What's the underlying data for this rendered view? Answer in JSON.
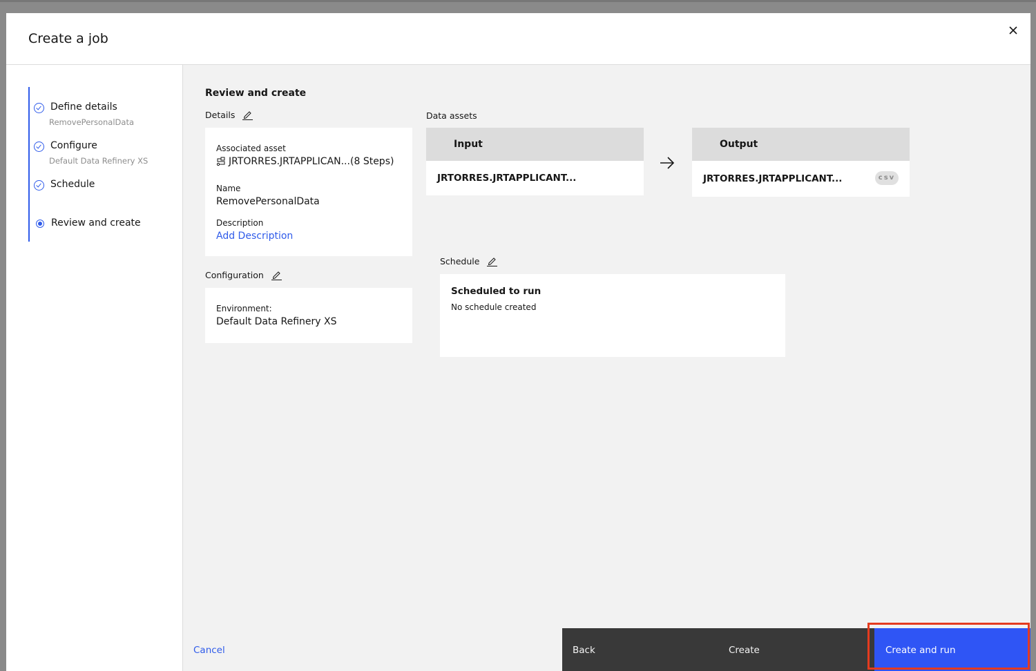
{
  "modal": {
    "title": "Create a job",
    "close_label": "×"
  },
  "steps": [
    {
      "label": "Define details",
      "sub": "RemovePersonalData",
      "status": "complete"
    },
    {
      "label": "Configure",
      "sub": "Default Data Refinery XS",
      "status": "complete"
    },
    {
      "label": "Schedule",
      "sub": "",
      "status": "complete"
    },
    {
      "label": "Review and create",
      "sub": "",
      "status": "current"
    }
  ],
  "review": {
    "title": "Review and create",
    "details": {
      "label": "Details",
      "associated_asset_label": "Associated asset",
      "associated_asset_value": "JRTORRES.JRTAPPLICAN...",
      "associated_asset_steps": "(8 Steps)",
      "name_label": "Name",
      "name_value": "RemovePersonalData",
      "description_label": "Description",
      "description_link": "Add Description"
    },
    "configuration": {
      "label": "Configuration",
      "environment_label": "Environment:",
      "environment_value": "Default Data Refinery XS"
    },
    "data_assets": {
      "label": "Data assets",
      "input_header": "Input",
      "input_value": "JRTORRES.JRTAPPLICANT...",
      "output_header": "Output",
      "output_value": "JRTORRES.JRTAPPLICANT...",
      "output_badge": "csv"
    },
    "schedule": {
      "label": "Schedule",
      "heading": "Scheduled to run",
      "value": "No schedule created"
    }
  },
  "footer": {
    "cancel": "Cancel",
    "back": "Back",
    "create": "Create",
    "create_and_run": "Create and run"
  },
  "colors": {
    "accent": "#2f55f5",
    "link": "#2f5bea",
    "secondary_button": "#393939",
    "highlight": "#e53b1f"
  }
}
